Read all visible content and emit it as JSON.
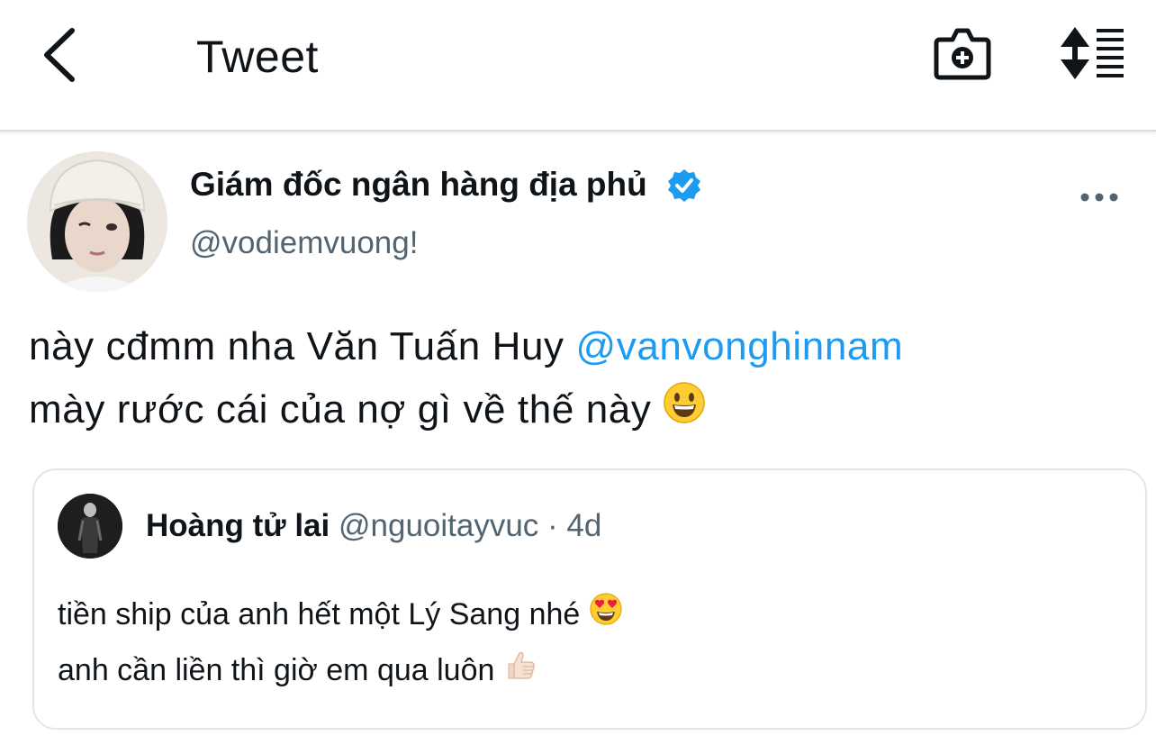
{
  "header": {
    "title": "Tweet",
    "back_icon": "chevron-left-icon",
    "camera_icon": "camera-plus-icon",
    "sort_icon": "sort-list-icon"
  },
  "tweet": {
    "author_name": "Giám đốc ngân hàng địa phủ",
    "author_handle": "@vodiemvuong!",
    "verified": true,
    "line1_text": "này cđmm nha Văn Tuấn Huy ",
    "mention": "@vanvonghinnam",
    "line2_text": "mày rước cái của nợ gì về thế này ",
    "line2_emoji": "grinning-face-emoji"
  },
  "quoted_tweet": {
    "author_name": "Hoàng tử lai",
    "author_handle": "@nguoitayvuc",
    "separator": " · ",
    "time": "4d",
    "line1_text": "tiền ship của anh hết một Lý Sang nhé ",
    "line1_emoji": "heart-eyes-emoji",
    "line2_text": "anh cần liền thì giờ em qua luôn ",
    "line2_emoji": "thumbs-up-emoji"
  },
  "colors": {
    "accent": "#1d9bf0",
    "text_primary": "#0f1419",
    "text_secondary": "#536471",
    "border": "#e1e6ea"
  }
}
